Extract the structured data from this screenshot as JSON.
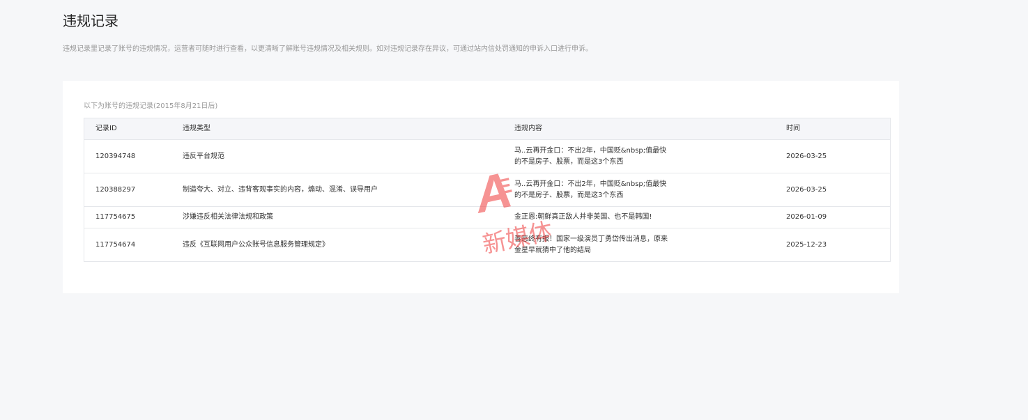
{
  "page": {
    "title": "违规记录",
    "description": "违规记录里记录了账号的违规情况，运营者可随时进行查看，以更清晰了解账号违规情况及相关规则。如对违规记录存在异议，可通过站内信处罚通知的申诉入口进行申诉。"
  },
  "records": {
    "caption": "以下为账号的违规记录(2015年8月21日后)",
    "columns": {
      "id": "记录ID",
      "type": "违规类型",
      "content": "违规内容",
      "time": "时间"
    },
    "rows": [
      {
        "id": "120394748",
        "type": "违反平台规范",
        "content": "马..云再开金口：不出2年，中国贬&nbsp;值最快的不是房子、股票，而是这3个东西",
        "time": "2026-03-25"
      },
      {
        "id": "120388297",
        "type": "制造夸大、对立、违背客观事实的内容，煽动、混淆、误导用户",
        "content": "马..云再开金口：不出2年，中国贬&nbsp;值最快的不是房子、股票，而是这3个东西",
        "time": "2026-03-25"
      },
      {
        "id": "117754675",
        "type": "涉嫌违反相关法律法规和政策",
        "content": "金正恩:朝鲜真正敌人并非美国、也不是韩国!",
        "time": "2026-01-09"
      },
      {
        "id": "117754674",
        "type": "违反《互联网用户公众账号信息服务管理规定》",
        "content": "善恶终有报！国家一级演员丁勇岱传出消息，原来金星早就猜中了他的结局",
        "time": "2025-12-23"
      }
    ]
  },
  "watermark": {
    "logo_text": "A",
    "text": "新媒体",
    "color": "#f03c3c"
  }
}
